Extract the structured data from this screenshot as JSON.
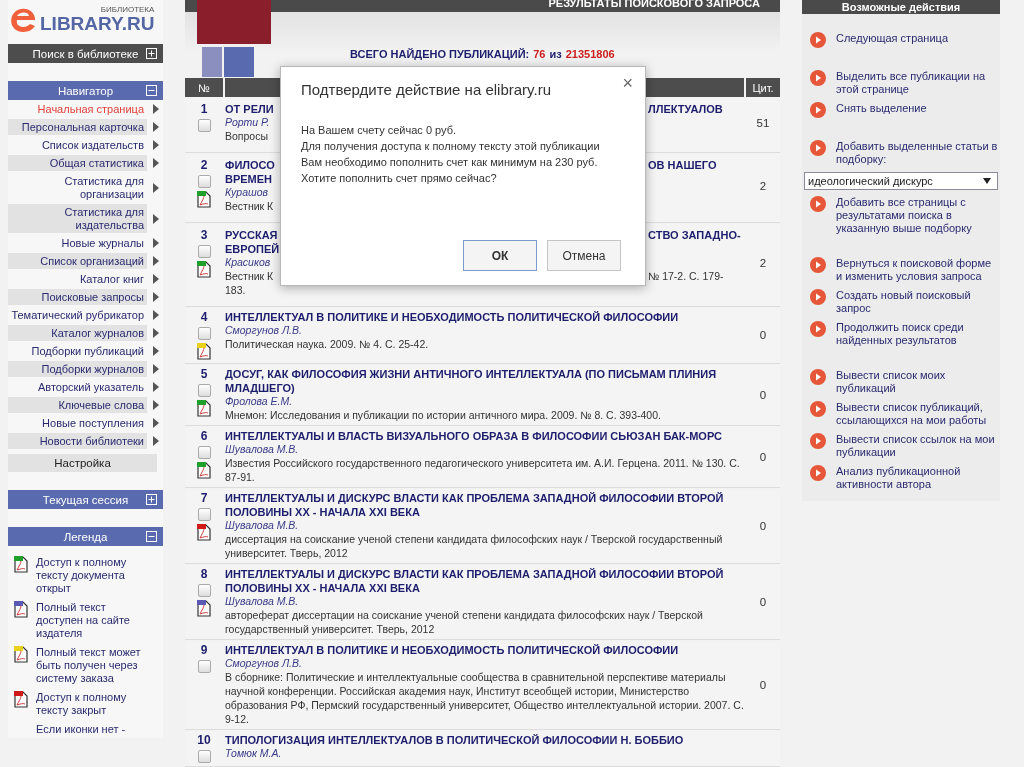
{
  "logo": {
    "caption": "БИБЛИОТЕКА",
    "name": "LIBRARY.RU"
  },
  "left_panels": [
    {
      "title": "Поиск в библиотеке",
      "kind": "search",
      "expanded": false
    },
    {
      "title": "Навигатор",
      "kind": "nav",
      "expanded": true,
      "items": [
        {
          "label": "Начальная страница",
          "selected": true
        },
        {
          "label": "Персональная карточка",
          "selected": false
        },
        {
          "label": "Список издательств",
          "selected": false
        },
        {
          "label": "Общая статистика",
          "selected": false
        },
        {
          "label": "Статистика для организации",
          "selected": false
        },
        {
          "label": "Статистика для издательства",
          "selected": false
        },
        {
          "label": "Новые журналы",
          "selected": false
        },
        {
          "label": "Список организаций",
          "selected": false
        },
        {
          "label": "Каталог книг",
          "selected": false
        },
        {
          "label": "Поисковые запросы",
          "selected": false
        },
        {
          "label": "Тематический рубрикатор",
          "selected": false
        },
        {
          "label": "Каталог журналов",
          "selected": false
        },
        {
          "label": "Подборки публикаций",
          "selected": false
        },
        {
          "label": "Подборки журналов",
          "selected": false
        },
        {
          "label": "Авторский указатель",
          "selected": false
        },
        {
          "label": "Ключевые слова",
          "selected": false
        },
        {
          "label": "Новые поступления",
          "selected": false
        },
        {
          "label": "Новости библиотеки",
          "selected": false
        }
      ],
      "footer": "Настройка"
    },
    {
      "title": "Текущая сессия",
      "kind": "session",
      "expanded": false
    },
    {
      "title": "Легенда",
      "kind": "legend",
      "expanded": true,
      "items": [
        {
          "label": "Доступ к полному тексту документа открыт",
          "color": "#1fa02a"
        },
        {
          "label": "Полный текст доступен на сайте издателя",
          "color": "#5a5ab4"
        },
        {
          "label": "Полный текст может быть получен через систему заказа",
          "color": "#e8d21e"
        },
        {
          "label": "Доступ к полному тексту закрыт",
          "color": "#d01a1a"
        }
      ],
      "footer": "Если иконки нет -"
    }
  ],
  "banner": {
    "title": "РЕЗУЛЬТАТЫ ПОИСКОВОГО ЗАПРОСА"
  },
  "summary": {
    "label": "ВСЕГО НАЙДЕНО ПУБЛИКАЦИЙ:",
    "found": "76",
    "separator": "из",
    "total": "21351806"
  },
  "table": {
    "columns": [
      "№",
      "Цит."
    ],
    "rows": [
      {
        "kind": "covered",
        "number": "1",
        "checked": false,
        "title_lines": [
          [
            "ОТ РЕЛИ",
            "ЛЛЕКТУАЛОВ"
          ]
        ],
        "author": "Рорти Р.",
        "source_lines": [
          [
            "Вопросы"
          ]
        ],
        "citations": "51"
      },
      {
        "kind": "covered",
        "number": "2",
        "checked": false,
        "icon": {
          "color": "#1fa02a"
        },
        "title_lines": [
          [
            "ФИЛОСО",
            "ОВ НАШЕГО"
          ],
          [
            "ВРЕМЕН"
          ]
        ],
        "author": "Курашов",
        "source_lines": [
          [
            "Вестник К"
          ]
        ],
        "citations": "2"
      },
      {
        "kind": "covered",
        "number": "3",
        "checked": false,
        "icon": {
          "color": "#1fa02a"
        },
        "title_lines": [
          [
            "РУССКАЯ",
            "СТВО ЗАПАДНО-"
          ],
          [
            "ЕВРОПЕЙ"
          ]
        ],
        "author": "Красиков",
        "source_lines": [
          [
            "Вестник К",
            "№ 17-2. С. 179-"
          ],
          [
            "183."
          ]
        ],
        "citations": "2"
      },
      {
        "kind": "full",
        "number": "4",
        "checked": false,
        "icon": {
          "color": "#e8d21e"
        },
        "title": "ИНТЕЛЛЕКТУАЛ В ПОЛИТИКЕ И НЕОБХОДИМОСТЬ ПОЛИТИЧЕСКОЙ ФИЛОСОФИИ",
        "author": "Сморгунов Л.В.",
        "source": "Политическая наука. 2009. № 4. С. 25-42.",
        "citations": "0"
      },
      {
        "kind": "full",
        "number": "5",
        "checked": false,
        "icon": {
          "color": "#1fa02a"
        },
        "title": "ДОСУГ, КАК ФИЛОСОФИЯ ЖИЗНИ АНТИЧНОГО ИНТЕЛЛЕКТУАЛА (ПО ПИСЬМАМ ПЛИНИЯ МЛАДШЕГО)",
        "author": "Фролова Е.М.",
        "source": "Мнемон: Исследования и публикации по истории античного мира. 2009. № 8. С. 393-400.",
        "citations": "0"
      },
      {
        "kind": "full",
        "number": "6",
        "checked": false,
        "icon": {
          "color": "#1fa02a"
        },
        "title": "ИНТЕЛЛЕКТУАЛЫ И ВЛАСТЬ ВИЗУАЛЬНОГО ОБРАЗА В ФИЛОСОФИИ СЬЮЗАН БАК-МОРС",
        "author": "Шувалова М.В.",
        "source": "Известия Российского государственного педагогического университета им. А.И. Герцена. 2011. № 130. С. 87-91.",
        "citations": "0"
      },
      {
        "kind": "full",
        "number": "7",
        "checked": false,
        "icon": {
          "color": "#d01a1a"
        },
        "title": "ИНТЕЛЛЕКТУАЛЫ И ДИСКУРС ВЛАСТИ КАК ПРОБЛЕМА ЗАПАДНОЙ ФИЛОСОФИИ ВТОРОЙ ПОЛОВИНЫ XX - НАЧАЛА XXI ВЕКА",
        "author": "Шувалова М.В.",
        "source": "диссертация на соискание ученой степени кандидата философских наук / Тверской государственный университет. Тверь, 2012",
        "citations": "0"
      },
      {
        "kind": "full",
        "number": "8",
        "checked": false,
        "icon": {
          "color": "#5a5ab4"
        },
        "title": "ИНТЕЛЛЕКТУАЛЫ И ДИСКУРС ВЛАСТИ КАК ПРОБЛЕМА ЗАПАДНОЙ ФИЛОСОФИИ ВТОРОЙ ПОЛОВИНЫ XX - НАЧАЛА XXI ВЕКА",
        "author": "Шувалова М.В.",
        "source": "автореферат диссертации на соискание ученой степени кандидата философских наук / Тверской государственный университет. Тверь, 2012",
        "citations": "0"
      },
      {
        "kind": "full",
        "number": "9",
        "checked": false,
        "title": "ИНТЕЛЛЕКТУАЛ В ПОЛИТИКЕ И НЕОБХОДИМОСТЬ ПОЛИТИЧЕСКОЙ ФИЛОСОФИИ",
        "author": "Сморгунов Л.В.",
        "source": "В сборнике: Политические и интеллектуальные сообщества в сравнительной перспективе материалы научной конференции. Российская академия наук, Институт всеобщей истории, Министерство образования РФ, Пермский государственный университет, Общество интеллектуальной истории. 2007. С. 9-12.",
        "citations": "0"
      },
      {
        "kind": "full",
        "number": "10",
        "checked": false,
        "title": "ТИПОЛОГИЗАЦИЯ ИНТЕЛЛЕКТУАЛОВ В ПОЛИТИЧЕСКОЙ ФИЛОСОФИИ Н. БОББИО",
        "author": "Томюк М.А."
      }
    ]
  },
  "actions": {
    "title": "Возможные действия",
    "groups": [
      [
        {
          "kind": "action",
          "label": "Следующая страница"
        }
      ],
      [
        {
          "kind": "action",
          "label": "Выделить все публикации на этой странице"
        },
        {
          "kind": "action",
          "label": "Снять выделение"
        }
      ],
      [
        {
          "kind": "action",
          "label": "Добавить выделенные статьи в подборку:"
        },
        {
          "kind": "select",
          "value": "идеологический дискурс"
        },
        {
          "kind": "action",
          "label": "Добавить все страницы с результатами поиска в указанную выше подборку"
        }
      ],
      [
        {
          "kind": "action",
          "label": "Вернуться к поисковой форме и изменить условия запроса"
        },
        {
          "kind": "action",
          "label": "Создать новый поисковый запрос"
        },
        {
          "kind": "action",
          "label": "Продолжить поиск среди найденных результатов"
        }
      ],
      [
        {
          "kind": "action",
          "label": "Вывести список моих публикаций"
        },
        {
          "kind": "action",
          "label": "Вывести список публикаций, ссылающихся на мои работы"
        },
        {
          "kind": "action",
          "label": "Вывести список ссылок на мои публикации"
        },
        {
          "kind": "action",
          "label": "Анализ публикационной активности автора"
        }
      ]
    ]
  },
  "dialog": {
    "title": "Подтвердите действие на elibrary.ru",
    "close": "×",
    "paragraphs": [
      "На Вашем счету сейчас 0 руб.",
      "Для получения доступа к полному тексту этой публикации Вам необходимо пополнить счет как минимум на 230 руб.",
      "Хотите пополнить счет прямо сейчас?"
    ],
    "buttons": [
      {
        "label": "ОК",
        "default": true
      },
      {
        "label": "Отмена",
        "default": false
      }
    ]
  }
}
